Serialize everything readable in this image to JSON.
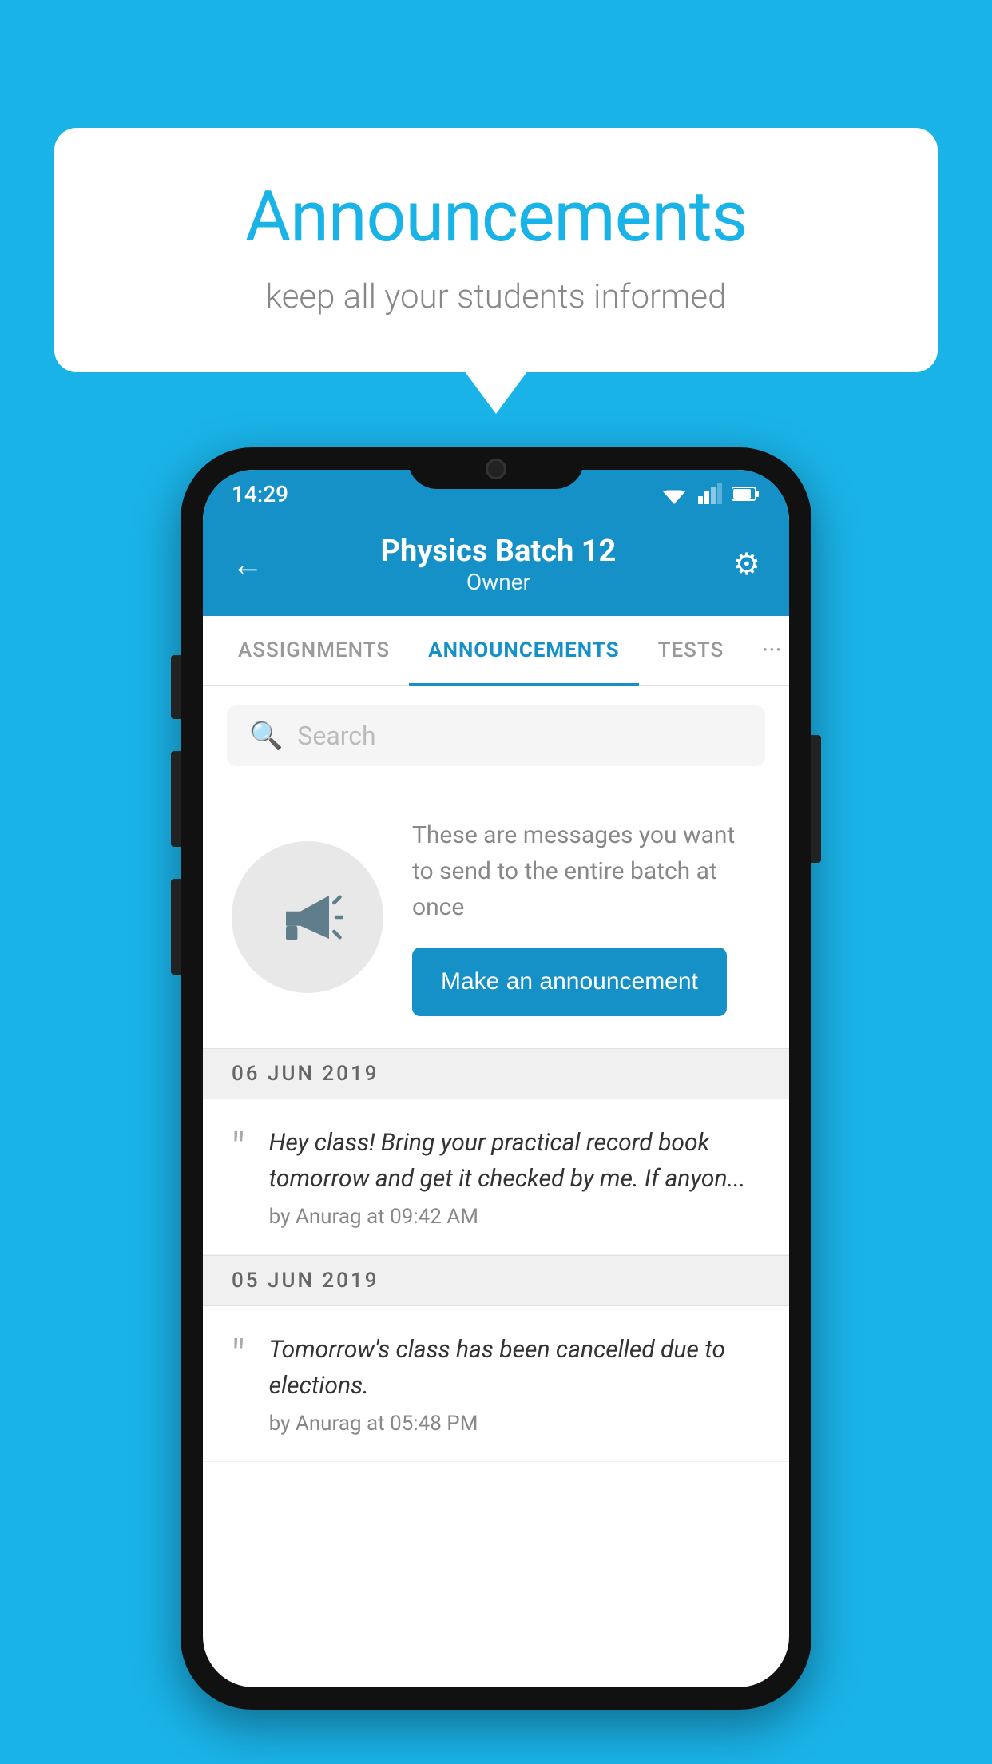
{
  "page": {
    "background_color": "#1ab3e8"
  },
  "speech_bubble": {
    "title": "Announcements",
    "subtitle": "keep all your students informed"
  },
  "phone": {
    "status_bar": {
      "time": "14:29"
    },
    "header": {
      "title": "Physics Batch 12",
      "subtitle": "Owner",
      "back_label": "←",
      "gear_label": "⚙"
    },
    "tabs": [
      {
        "label": "ASSIGNMENTS",
        "active": false
      },
      {
        "label": "ANNOUNCEMENTS",
        "active": true
      },
      {
        "label": "TESTS",
        "active": false
      },
      {
        "label": "···",
        "active": false
      }
    ],
    "search": {
      "placeholder": "Search"
    },
    "announce_prompt": {
      "description": "These are messages you want to send to the entire batch at once",
      "button_label": "Make an announcement"
    },
    "announcements": [
      {
        "date": "06  JUN  2019",
        "text": "Hey class! Bring your practical record book tomorrow and get it checked by me. If anyon...",
        "meta": "by Anurag at 09:42 AM"
      },
      {
        "date": "05  JUN  2019",
        "text": "Tomorrow's class has been cancelled due to elections.",
        "meta": "by Anurag at 05:48 PM"
      }
    ]
  }
}
